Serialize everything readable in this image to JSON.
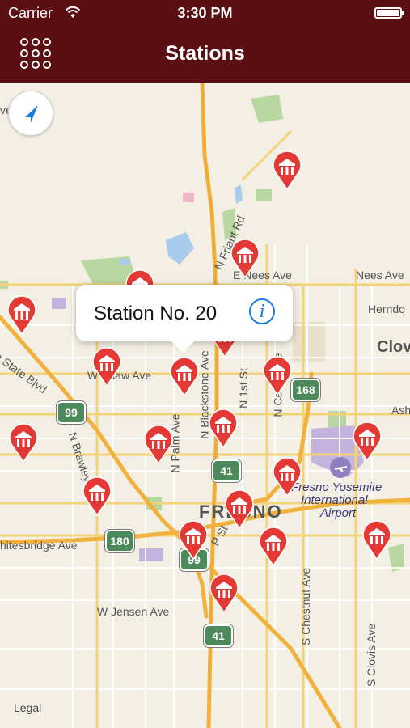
{
  "status_bar": {
    "carrier": "Carrier",
    "time": "3:30 PM"
  },
  "nav": {
    "title": "Stations"
  },
  "map": {
    "labels": {
      "venue": "venue",
      "friant": "N Friant Rd",
      "nees1": "E Nees Ave",
      "nees2": "Nees Ave",
      "herndon": "Herndo",
      "clovis": "Clov",
      "state_blvd": "n State Blvd",
      "shaw": "W Shaw Ave",
      "blackstone": "N Blackstone Ave",
      "first": "N 1st St",
      "cedar": "N Cedar Ave",
      "ash": "Ash",
      "palm": "N Palm Ave",
      "brawley": "N Brawley Ave",
      "fresno": "FRESNO",
      "airport1": "Fresno Yosemite",
      "airport2": "International",
      "airport3": "Airport",
      "whitesbridge": "hitesbridge Ave",
      "pst": "P St",
      "jensen": "W Jensen Ave",
      "chestnut": "S Chestnut Ave",
      "clovis_ave": "S Clovis Ave"
    },
    "shields": {
      "r99a": "99",
      "r99b": "99",
      "r168": "168",
      "r41a": "41",
      "r41b": "41",
      "r180": "180"
    },
    "callout": {
      "title": "Station No. 20"
    },
    "legal": "Legal"
  },
  "colors": {
    "brand": "#5b0f13",
    "pin": "#e53935",
    "accent": "#1a7be0"
  }
}
